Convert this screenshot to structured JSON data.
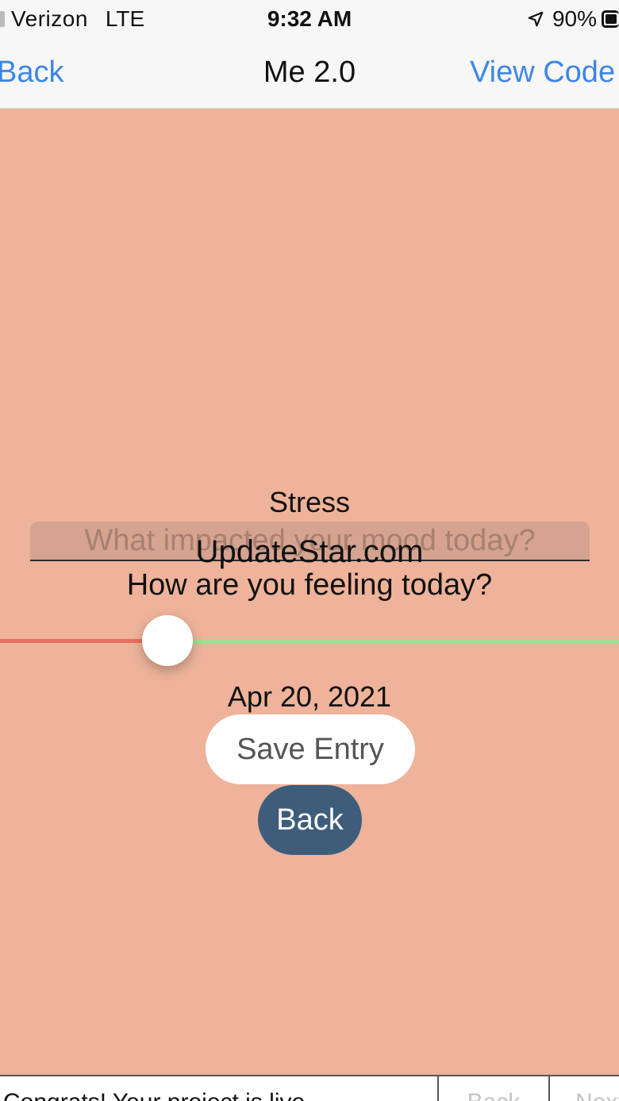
{
  "status_bar": {
    "carrier": "Verizon",
    "network": "LTE",
    "time": "9:32 AM",
    "battery": "90%"
  },
  "nav": {
    "back_label": "Back",
    "title": "Me 2.0",
    "view_code_label": "View Code"
  },
  "content": {
    "mood_label": "Stress",
    "input_placeholder": "What impacted your mood today?",
    "input_value": "",
    "watermark": "UpdateStar.com",
    "question": "How are you feeling today?",
    "slider_value": 0.27,
    "date": "Apr 20, 2021",
    "save_label": "Save Entry",
    "back_label": "Back"
  },
  "bottom_bar": {
    "message": "Congrats! Your project is live.",
    "back_label": "Back",
    "next_label": "Next"
  },
  "colors": {
    "background": "#eeb39a",
    "link": "#3d86e6",
    "slider_min": "#e8705e",
    "slider_max": "#9fe190",
    "back_button": "#3e5d7a"
  },
  "icons": {
    "location": "location-arrow-icon",
    "battery": "battery-icon"
  }
}
